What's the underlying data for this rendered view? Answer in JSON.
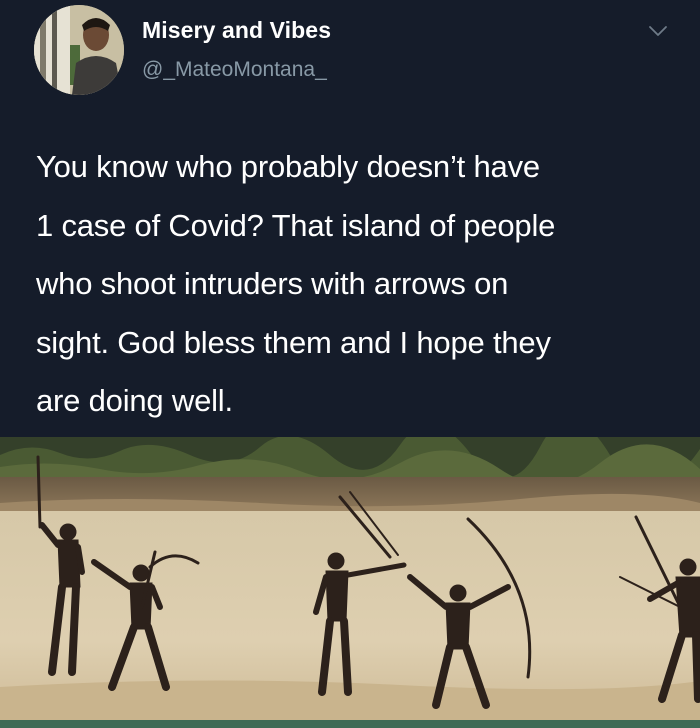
{
  "tweet": {
    "author_name": "Misery and Vibes",
    "author_handle": "@_MateoMontana_",
    "avatar_icon": "profile-photo",
    "menu_icon": "chevron-down-icon",
    "text_lines": [
      "You know who probably doesn’t have",
      "1 case of Covid? That island of people",
      "who shoot intruders with arrows on",
      "sight. God bless them and I hope they",
      "are doing well."
    ]
  },
  "photo": {
    "subject": "people-with-bows-on-beach"
  },
  "colors": {
    "background": "#151c2a",
    "text": "#ffffff",
    "handle": "#8899a6",
    "chevron": "#6e7b88",
    "sand": "#d9c7a4",
    "vegetation": "#3e4a2e",
    "figures": "#2c211b"
  }
}
